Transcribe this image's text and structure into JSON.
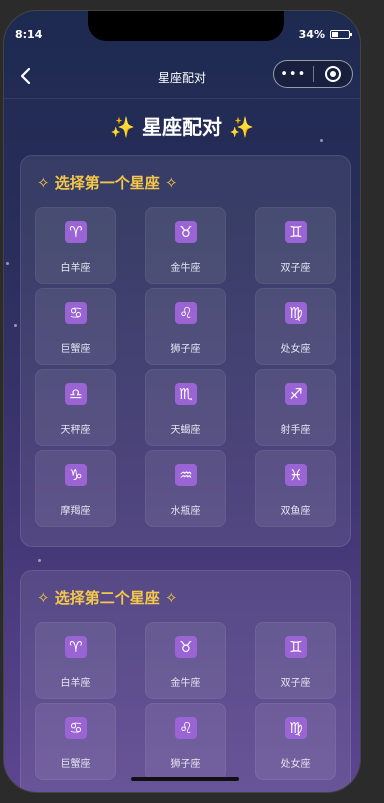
{
  "status": {
    "time": "8:14",
    "battery": "34%"
  },
  "nav": {
    "title": "星座配对",
    "more": "•••"
  },
  "page": {
    "title_left": "✨",
    "title": " 星座配对 ",
    "title_right": "✨"
  },
  "section1": {
    "title": "✧ 选择第一个星座 ✧"
  },
  "section2": {
    "title": "✧ 选择第二个星座 ✧"
  },
  "signs": [
    {
      "symbol": "♈",
      "name": "白羊座"
    },
    {
      "symbol": "♉",
      "name": "金牛座"
    },
    {
      "symbol": "♊",
      "name": "双子座"
    },
    {
      "symbol": "♋",
      "name": "巨蟹座"
    },
    {
      "symbol": "♌",
      "name": "狮子座"
    },
    {
      "symbol": "♍",
      "name": "处女座"
    },
    {
      "symbol": "♎",
      "name": "天秤座"
    },
    {
      "symbol": "♏",
      "name": "天蝎座"
    },
    {
      "symbol": "♐",
      "name": "射手座"
    },
    {
      "symbol": "♑",
      "name": "摩羯座"
    },
    {
      "symbol": "♒",
      "name": "水瓶座"
    },
    {
      "symbol": "♓",
      "name": "双鱼座"
    }
  ],
  "icons": {
    "back": "chevron-left-icon",
    "close": "target-icon",
    "battery": "battery-icon"
  }
}
